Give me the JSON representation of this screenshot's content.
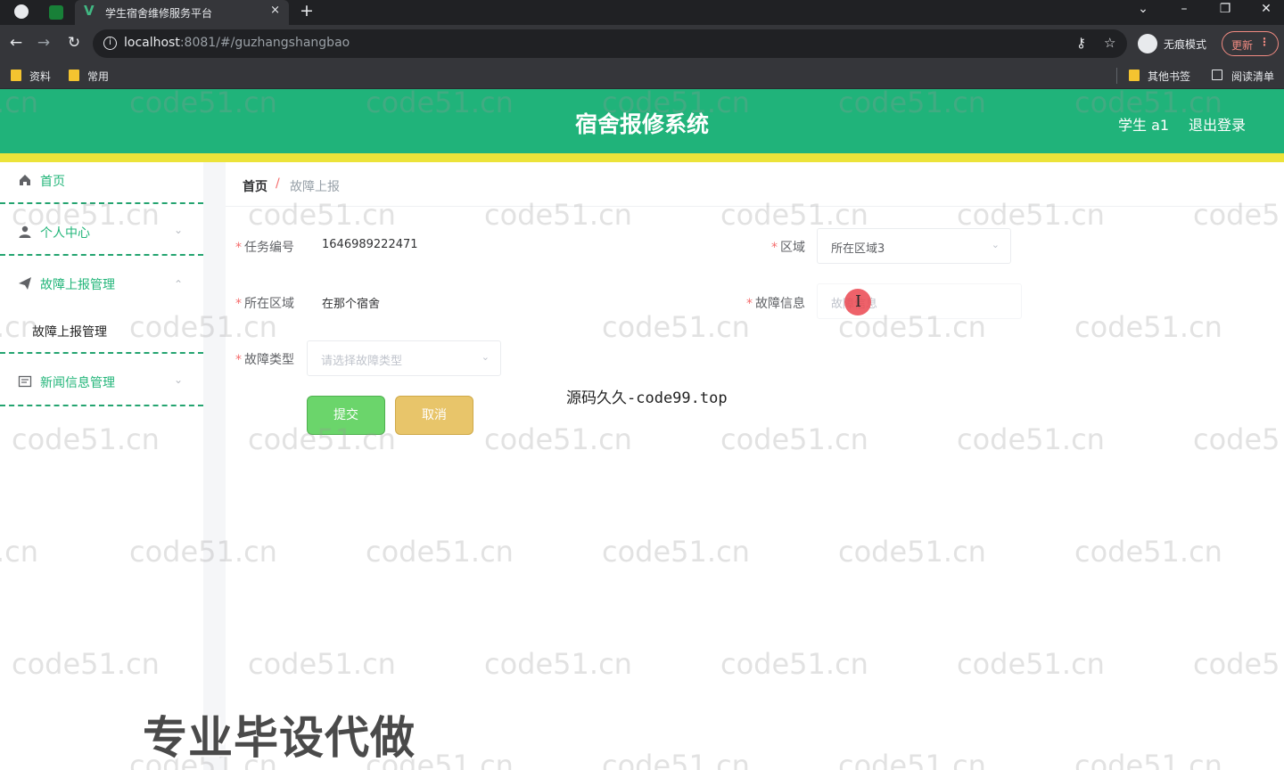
{
  "browser": {
    "tab_title": "学生宿舍维修服务平台",
    "tab_close": "×",
    "new_tab": "+",
    "url_host": "localhost",
    "url_rest": ":8081/#/guzhangshangbao",
    "incognito_label": "无痕模式",
    "update_label": "更新",
    "bookmarks": [
      "资料",
      "常用"
    ],
    "other_bookmarks": "其他书签",
    "reading_list": "阅读清单"
  },
  "header": {
    "title": "宿舍报修系统",
    "user": "学生 a1",
    "logout": "退出登录"
  },
  "sidebar": {
    "items": [
      {
        "label": "首页",
        "icon": "home-icon"
      },
      {
        "label": "个人中心",
        "icon": "user-icon",
        "arrow": "⌄"
      },
      {
        "label": "故障上报管理",
        "icon": "send-icon",
        "arrow": "⌃"
      },
      {
        "label": "新闻信息管理",
        "icon": "news-icon",
        "arrow": "⌄"
      }
    ],
    "submenu": "故障上报管理"
  },
  "breadcrumb": {
    "home": "首页",
    "separator": "/",
    "current": "故障上报"
  },
  "form": {
    "required_mark": "*",
    "task_no_label": "任务编号",
    "task_no_value": "1646989222471",
    "region_label": "区域",
    "region_value": "所在区域3",
    "location_label": "所在区域",
    "location_value": "在那个宿舍",
    "fault_info_label": "故障信息",
    "fault_info_placeholder": "故障信息",
    "fault_type_label": "故障类型",
    "fault_type_placeholder": "请选择故障类型",
    "submit": "提交",
    "cancel": "取消"
  },
  "overlays": {
    "watermark": "code51.cn",
    "watermark_partial_left": ".cn",
    "watermark_partial_right": "code5",
    "code99": "源码久久-code99.top",
    "promo": "专业毕设代做"
  },
  "colors": {
    "header_green": "#20b37a",
    "stripe_yellow": "#ece33a",
    "menu_green": "#22b579",
    "submit_green": "#6bd56b",
    "cancel_gold": "#e8c56a",
    "required_red": "#f56c6c"
  }
}
